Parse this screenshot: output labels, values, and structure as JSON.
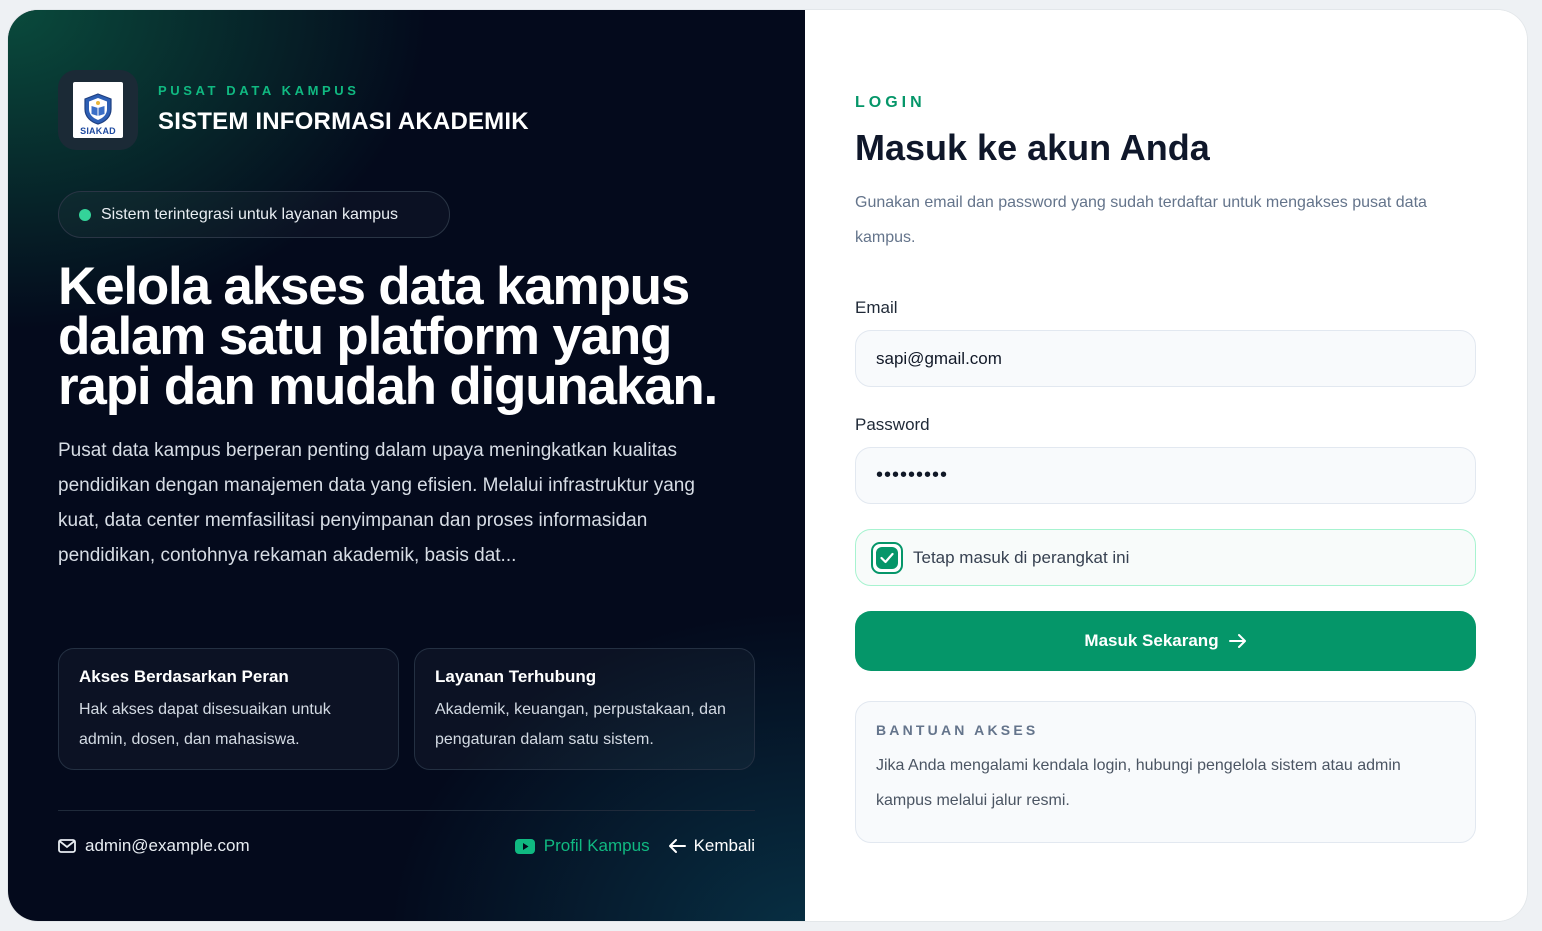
{
  "brand": {
    "logo_text": "SIAKAD",
    "eyebrow": "PUSAT DATA KAMPUS",
    "title": "SISTEM INFORMASI AKADEMIK"
  },
  "hero": {
    "pill_text": "Sistem terintegrasi untuk layanan kampus",
    "headline": "Kelola akses data kampus dalam satu platform yang rapi dan mudah digunakan.",
    "description": "Pusat data kampus berperan penting dalam upaya meningkatkan kualitas pendidikan dengan manajemen data yang efisien. Melalui infrastruktur yang kuat, data center memfasilitasi penyimpanan dan proses informasidan pendidikan, contohnya rekaman akademik, basis dat..."
  },
  "features": [
    {
      "title": "Akses Berdasarkan Peran",
      "body": "Hak akses dapat disesuaikan untuk admin, dosen, dan mahasiswa."
    },
    {
      "title": "Layanan Terhubung",
      "body": "Akademik, keuangan, perpustakaan, dan pengaturan dalam satu sistem."
    }
  ],
  "footer": {
    "email": "admin@example.com",
    "profile_link": "Profil Kampus",
    "back_link": "Kembali"
  },
  "login": {
    "eyebrow": "LOGIN",
    "title": "Masuk ke akun Anda",
    "subtitle": "Gunakan email dan password yang sudah terdaftar untuk mengakses pusat data kampus.",
    "email_label": "Email",
    "email_value": "sapi@gmail.com",
    "password_label": "Password",
    "password_value": "•••••••••",
    "remember_label": "Tetap masuk di perangkat ini",
    "remember_checked": true,
    "submit_label": "Masuk Sekarang"
  },
  "help": {
    "title": "BANTUAN AKSES",
    "body": "Jika Anda mengalami kendala login, hubungi pengelola sistem atau admin kampus melalui jalur resmi."
  },
  "colors": {
    "accent": "#059669",
    "accent_light": "#10b981",
    "dark_bg": "#040a1c"
  },
  "icons": [
    "siakad-logo-icon",
    "status-dot-icon",
    "mail-icon",
    "youtube-icon",
    "arrow-left-icon",
    "check-icon",
    "arrow-right-icon"
  ]
}
